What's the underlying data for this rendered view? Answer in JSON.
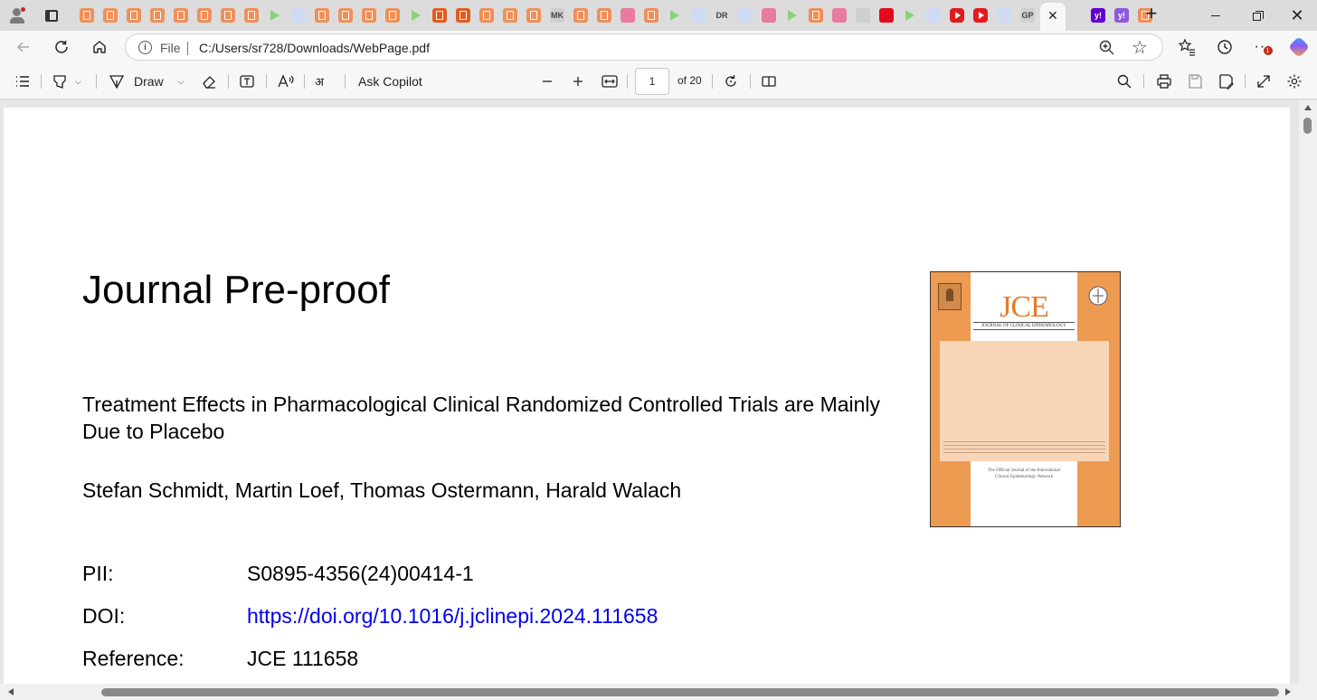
{
  "browser": {
    "url": "C:/Users/sr728/Downloads/WebPage.pdf",
    "scheme_label": "File",
    "tabs": [
      {
        "icon": "orange-doc-icon"
      },
      {
        "icon": "orange-doc-icon"
      },
      {
        "icon": "orange-doc-icon"
      },
      {
        "icon": "orange-doc-icon"
      },
      {
        "icon": "orange-doc-icon"
      },
      {
        "icon": "orange-doc-icon"
      },
      {
        "icon": "orange-doc-icon"
      },
      {
        "icon": "orange-doc-icon"
      },
      {
        "icon": "green-play-icon"
      },
      {
        "icon": "light-blue-icon"
      },
      {
        "icon": "orange-doc-icon"
      },
      {
        "icon": "orange-doc-icon"
      },
      {
        "icon": "orange-doc-icon"
      },
      {
        "icon": "orange-doc-icon"
      },
      {
        "icon": "green-play-icon"
      },
      {
        "icon": "orange-doc-dark-icon"
      },
      {
        "icon": "orange-doc-dark-icon"
      },
      {
        "icon": "orange-doc-icon"
      },
      {
        "icon": "orange-doc-icon"
      },
      {
        "icon": "orange-doc-icon"
      },
      {
        "icon": "mk-icon",
        "text": "MK"
      },
      {
        "icon": "orange-doc-icon"
      },
      {
        "icon": "orange-doc-icon"
      },
      {
        "icon": "pink-icon"
      },
      {
        "icon": "orange-doc-icon"
      },
      {
        "icon": "green-play-icon"
      },
      {
        "icon": "search-tab-icon"
      },
      {
        "icon": "dr-icon",
        "text": "DR"
      },
      {
        "icon": "light-blue-icon"
      },
      {
        "icon": "pink-icon"
      },
      {
        "icon": "green-play-icon"
      },
      {
        "icon": "orange-doc-icon"
      },
      {
        "icon": "pink-icon"
      },
      {
        "icon": "bird-icon"
      },
      {
        "icon": "red-r-icon"
      },
      {
        "icon": "green-play-icon"
      },
      {
        "icon": "light-blue-icon"
      },
      {
        "icon": "youtube-icon"
      },
      {
        "icon": "youtube-icon"
      },
      {
        "icon": "grid-icon"
      },
      {
        "icon": "gp-icon",
        "text": "GP"
      },
      {
        "icon": "mail-icon"
      },
      {
        "icon": "active-tab",
        "active": true
      },
      {
        "icon": "yahoo-icon",
        "text": "y!"
      },
      {
        "icon": "yahoo-light-icon",
        "text": "y!"
      },
      {
        "icon": "orange-doc-icon"
      }
    ]
  },
  "pdf_toolbar": {
    "draw_label": "Draw",
    "ask_copilot_label": "Ask Copilot",
    "page_number": "1",
    "page_count": "of 20"
  },
  "document": {
    "heading": "Journal Pre-proof",
    "title": "Treatment Effects in Pharmacological Clinical Randomized Controlled Trials are Mainly Due to Placebo",
    "authors": "Stefan Schmidt, Martin Loef, Thomas Ostermann, Harald Walach",
    "meta": {
      "pii_label": "PII:",
      "pii_value": "S0895-4356(24)00414-1",
      "doi_label": "DOI:",
      "doi_value": "https://doi.org/10.1016/j.jclinepi.2024.111658",
      "reference_label": "Reference:",
      "reference_value": "JCE 111658"
    },
    "cover": {
      "logo_text": "JCE",
      "subtitle": "JOURNAL OF CLINICAL EPIDEMIOLOGY",
      "network_line1": "The Official Journal of the International",
      "network_line2": "Clinical Epidemiology Network",
      "colors": {
        "background": "#ee9b52",
        "panel": "#f8d5b6",
        "logo": "#e57b2a"
      }
    }
  }
}
